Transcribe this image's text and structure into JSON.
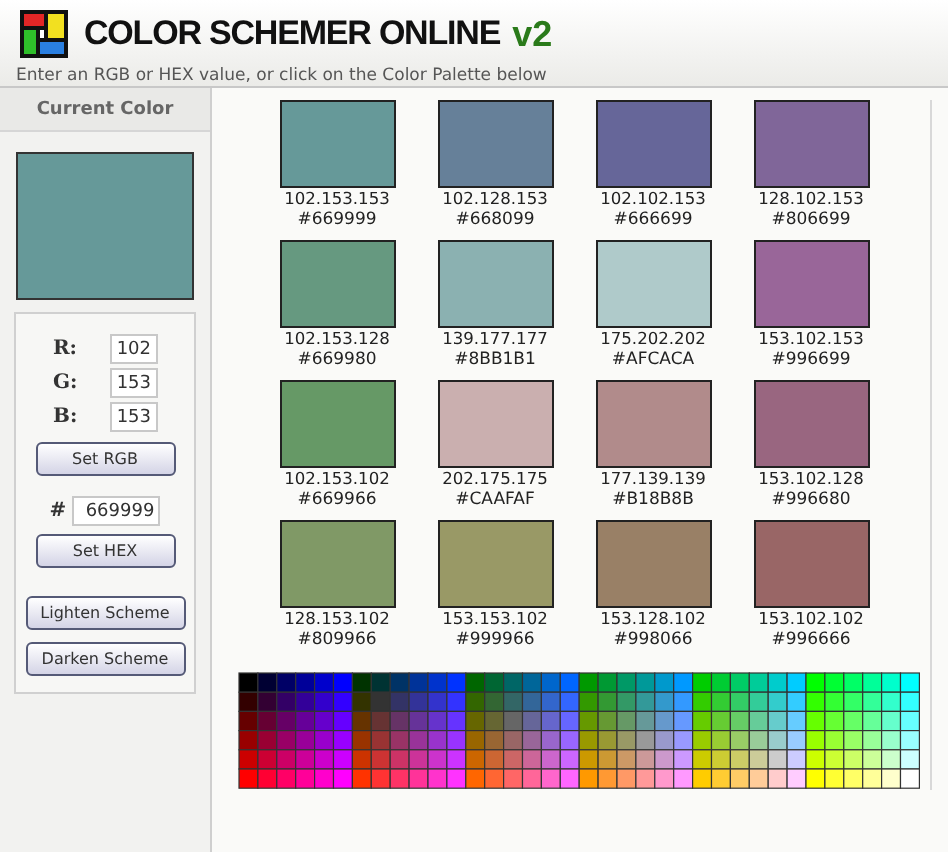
{
  "header": {
    "title": "COLOR SCHEMER ONLINE",
    "version": "v2",
    "subtitle": "Enter an RGB or HEX value, or click on the Color Palette below"
  },
  "current_color": {
    "heading": "Current Color",
    "color": "#669999"
  },
  "form": {
    "rgb": [
      {
        "label": "R:",
        "value": "102"
      },
      {
        "label": "G:",
        "value": "153"
      },
      {
        "label": "B:",
        "value": "153"
      }
    ],
    "set_rgb": "Set RGB",
    "hash": "#",
    "hex": "669999",
    "set_hex": "Set HEX",
    "lighten": "Lighten Scheme",
    "darken": "Darken Scheme"
  },
  "swatches": [
    {
      "rgb": "102.153.153",
      "hex": "#669999",
      "color": "#669999"
    },
    {
      "rgb": "102.128.153",
      "hex": "#668099",
      "color": "#668099"
    },
    {
      "rgb": "102.102.153",
      "hex": "#666699",
      "color": "#666699"
    },
    {
      "rgb": "128.102.153",
      "hex": "#806699",
      "color": "#806699"
    },
    {
      "rgb": "102.153.128",
      "hex": "#669980",
      "color": "#669980"
    },
    {
      "rgb": "139.177.177",
      "hex": "#8BB1B1",
      "color": "#8bb1b1"
    },
    {
      "rgb": "175.202.202",
      "hex": "#AFCACA",
      "color": "#afcaca"
    },
    {
      "rgb": "153.102.153",
      "hex": "#996699",
      "color": "#996699"
    },
    {
      "rgb": "102.153.102",
      "hex": "#669966",
      "color": "#669966"
    },
    {
      "rgb": "202.175.175",
      "hex": "#CAAFAF",
      "color": "#caafaf"
    },
    {
      "rgb": "177.139.139",
      "hex": "#B18B8B",
      "color": "#b18b8b"
    },
    {
      "rgb": "153.102.128",
      "hex": "#996680",
      "color": "#996680"
    },
    {
      "rgb": "128.153.102",
      "hex": "#809966",
      "color": "#809966"
    },
    {
      "rgb": "153.153.102",
      "hex": "#999966",
      "color": "#999966"
    },
    {
      "rgb": "153.128.102",
      "hex": "#998066",
      "color": "#998066"
    },
    {
      "rgb": "153.102.102",
      "hex": "#996666",
      "color": "#996666"
    }
  ]
}
